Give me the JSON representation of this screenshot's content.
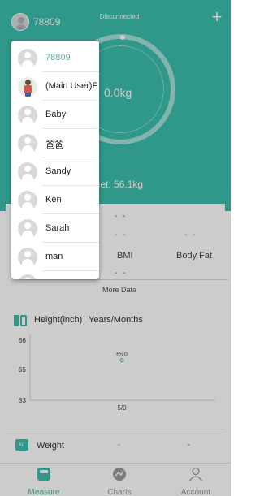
{
  "header": {
    "current_user": "78809",
    "connection_status": "Disconnected",
    "add_icon": "plus-icon",
    "weight_display": "0.0kg",
    "target_text": "Target: 56.1kg",
    "accent_color": "#3bbfad"
  },
  "metrics": {
    "row1_value": "- -",
    "bmi_value": "- -",
    "bodyfat_value": "- -",
    "bmi_label": "BMI",
    "bodyfat_label": "Body Fat",
    "row3_value": "- -",
    "more_data": "More Data"
  },
  "height_chart": {
    "title": "Height(inch)",
    "units": "Years/Months"
  },
  "chart_data": {
    "type": "scatter",
    "title": "Height(inch)",
    "xlabel": "Years/Months",
    "ylabel": "",
    "yticks": [
      "66",
      "65",
      "63"
    ],
    "ylim": [
      63,
      66
    ],
    "x": [
      "5/0"
    ],
    "series": [
      {
        "name": "",
        "values": [
          65.0
        ],
        "labels": [
          "65.0"
        ]
      }
    ]
  },
  "weight_row": {
    "label": "Weight",
    "value1": "-",
    "value2": "-"
  },
  "nav": {
    "measure": "Measure",
    "charts": "Charts",
    "account": "Account"
  },
  "user_menu": {
    "items": [
      {
        "label": "78809",
        "active": true
      },
      {
        "label": "(Main User)F",
        "photo": true
      },
      {
        "label": "Baby"
      },
      {
        "label": "爸爸"
      },
      {
        "label": "Sandy"
      },
      {
        "label": "Ken"
      },
      {
        "label": "Sarah"
      },
      {
        "label": "man"
      }
    ]
  }
}
